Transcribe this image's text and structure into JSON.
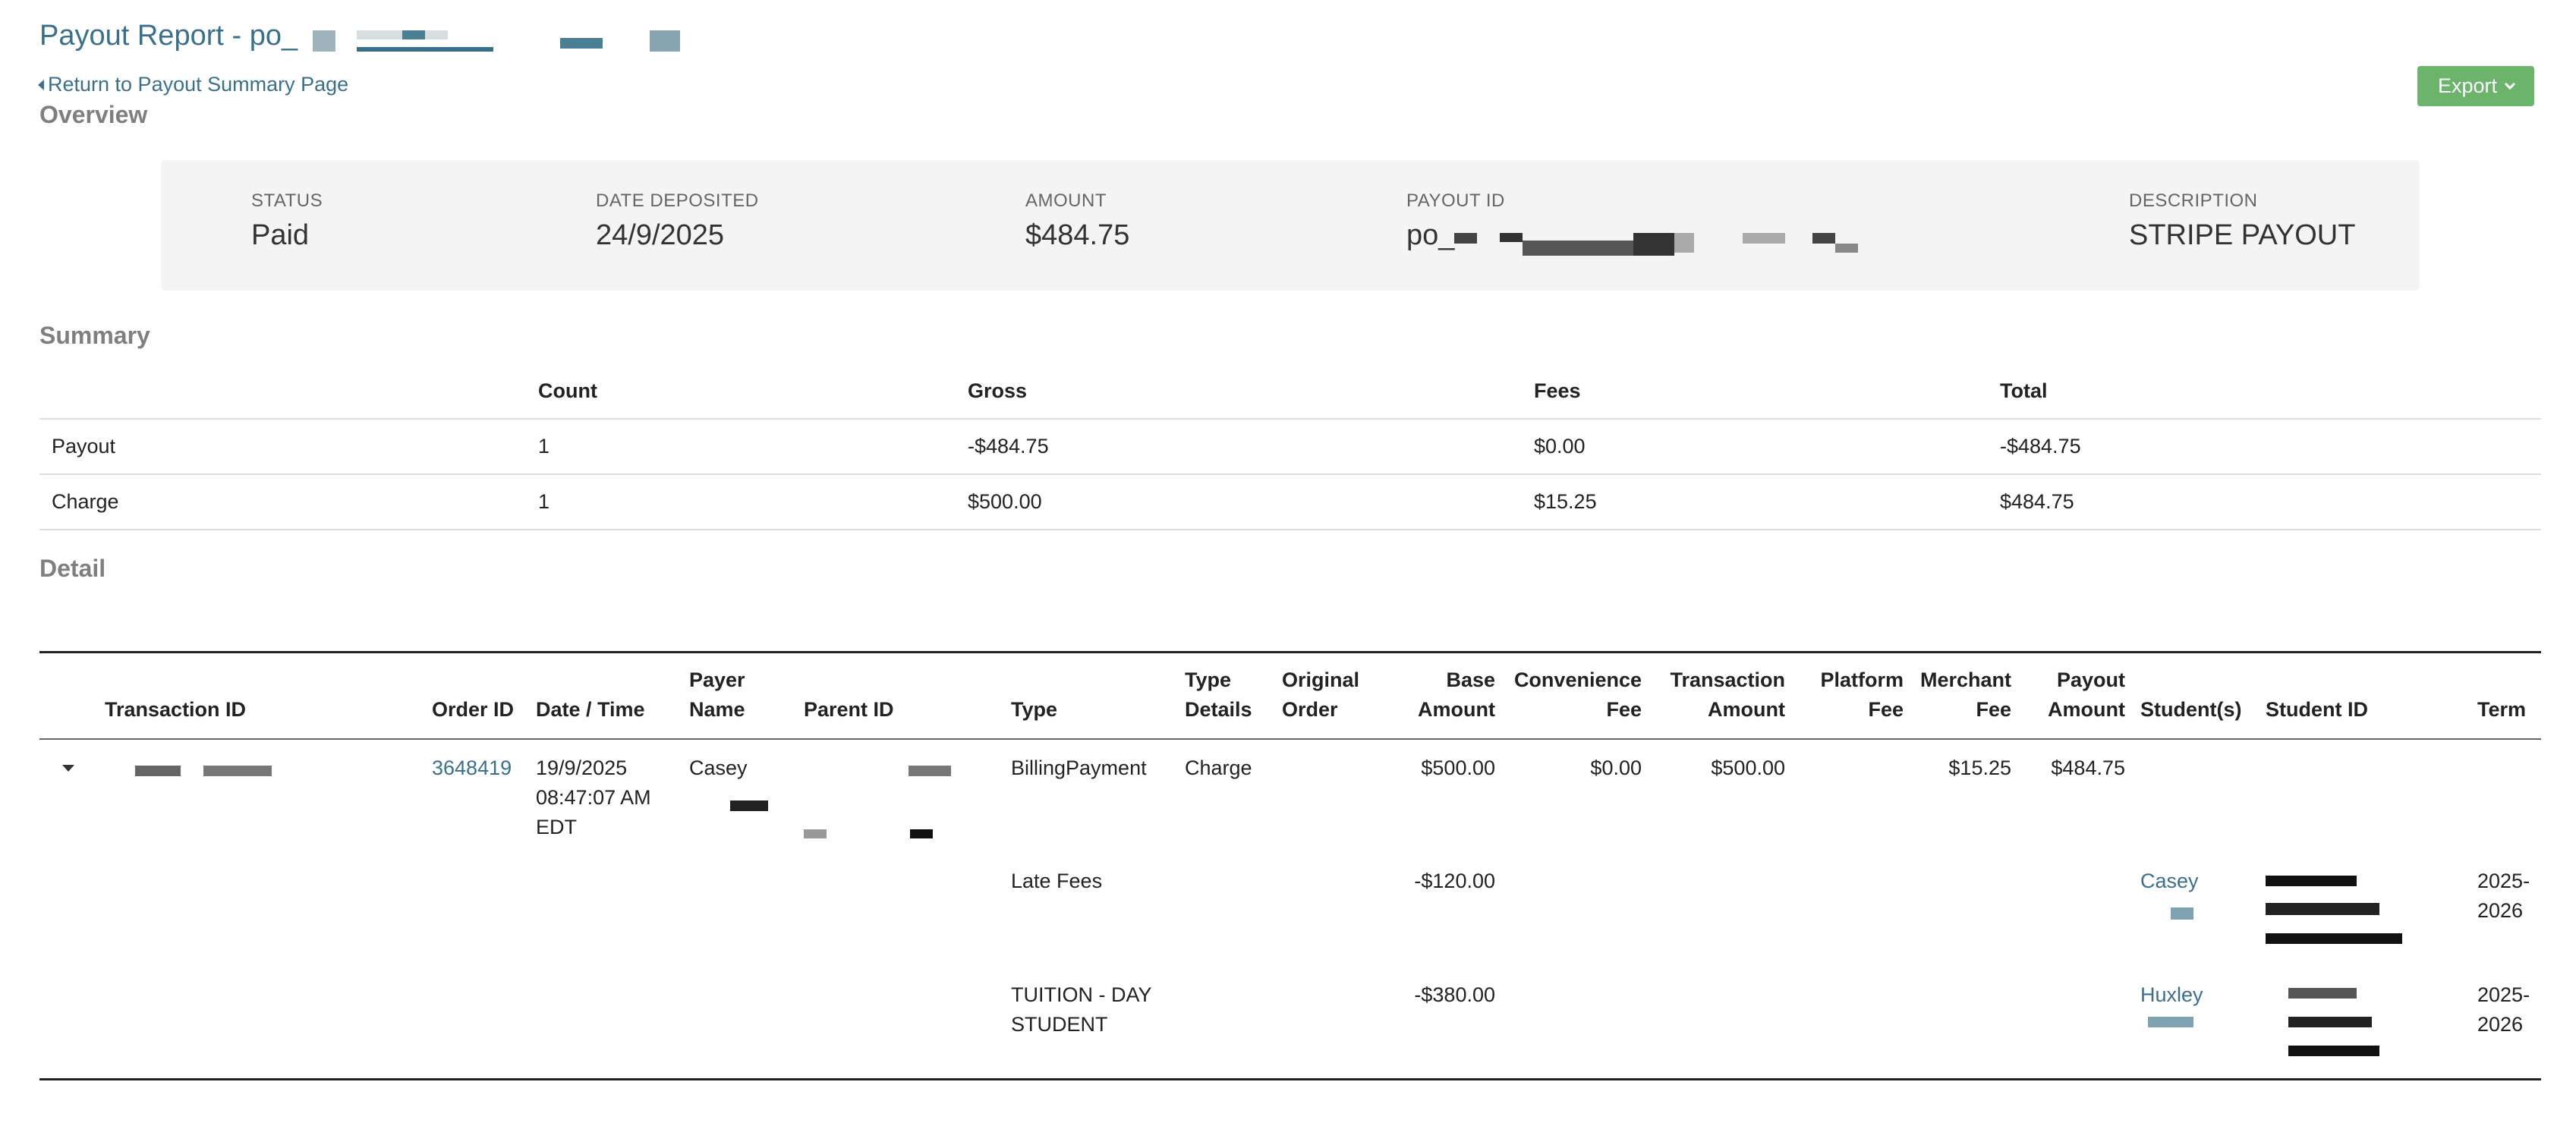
{
  "header": {
    "title": "Payout Report - po_",
    "back_link": "Return to Payout Summary Page",
    "export_label": "Export"
  },
  "overview": {
    "title": "Overview",
    "items": [
      {
        "label": "STATUS",
        "value": "Paid"
      },
      {
        "label": "DATE DEPOSITED",
        "value": "24/9/2025"
      },
      {
        "label": "AMOUNT",
        "value": "$484.75"
      },
      {
        "label": "PAYOUT ID",
        "value": "po_"
      },
      {
        "label": "DESCRIPTION",
        "value": "STRIPE PAYOUT"
      }
    ]
  },
  "summary": {
    "title": "Summary",
    "columns": [
      "",
      "Count",
      "Gross",
      "Fees",
      "Total"
    ],
    "rows": [
      [
        "Payout",
        "1",
        "-$484.75",
        "$0.00",
        "-$484.75"
      ],
      [
        "Charge",
        "1",
        "$500.00",
        "$15.25",
        "$484.75"
      ]
    ]
  },
  "detail": {
    "title": "Detail",
    "columns": {
      "transaction_id": "Transaction ID",
      "order_id": "Order ID",
      "date_time": "Date / Time",
      "payer_name": "Payer Name",
      "parent_id": "Parent ID",
      "type": "Type",
      "type_details": "Type Details",
      "original_order": "Original Order",
      "base_amount": "Base Amount",
      "convenience_fee": "Convenience Fee",
      "transaction_amount": "Transaction Amount",
      "platform_fee": "Platform Fee",
      "merchant_fee": "Merchant Fee",
      "payout_amount": "Payout Amount",
      "students": "Student(s)",
      "student_id": "Student ID",
      "term": "Term"
    },
    "main_row": {
      "order_id": "3648419",
      "date_time": "19/9/2025 08:47:07 AM EDT",
      "payer_name": "Casey",
      "type": "BillingPayment",
      "type_details": "Charge",
      "base_amount": "$500.00",
      "convenience_fee": "$0.00",
      "transaction_amount": "$500.00",
      "merchant_fee": "$15.25",
      "payout_amount": "$484.75"
    },
    "sub_rows": [
      {
        "type": "Late Fees",
        "base_amount": "-$120.00",
        "student": "Casey",
        "term": "2025-2026"
      },
      {
        "type": "TUITION - DAY STUDENT",
        "base_amount": "-$380.00",
        "student": "Huxley",
        "term": "2025-2026"
      }
    ]
  }
}
